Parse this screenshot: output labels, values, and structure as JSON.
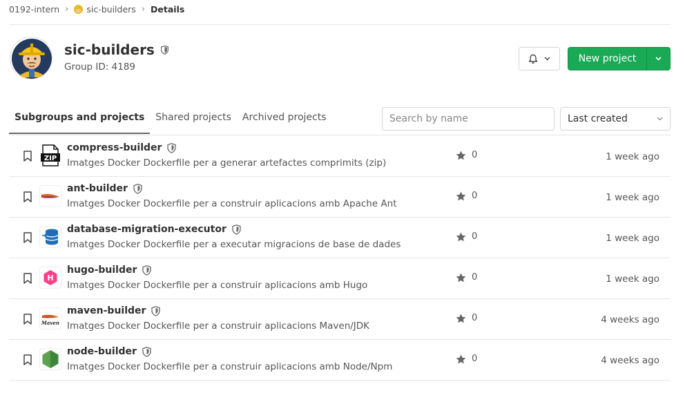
{
  "breadcrumb": {
    "items": [
      "0192-intern",
      "sic-builders",
      "Details"
    ]
  },
  "group": {
    "name": "sic-builders",
    "group_id_text": "Group ID: 4189"
  },
  "actions": {
    "new_project_label": "New project"
  },
  "tabs": [
    {
      "label": "Subgroups and projects",
      "active": true
    },
    {
      "label": "Shared projects",
      "active": false
    },
    {
      "label": "Archived projects",
      "active": false
    }
  ],
  "search": {
    "placeholder": "Search by name",
    "value": ""
  },
  "sort": {
    "selected": "Last created"
  },
  "projects": [
    {
      "name": "compress-builder",
      "description": "Imatges Docker Dockerfile per a generar artefactes comprimits (zip)",
      "stars": "0",
      "updated": "1 week ago",
      "icon": "zip-icon"
    },
    {
      "name": "ant-builder",
      "description": "Imatges Docker Dockerfile per a construir aplicacions amb Apache Ant",
      "stars": "0",
      "updated": "1 week ago",
      "icon": "ant-logo-icon"
    },
    {
      "name": "database-migration-executor",
      "description": "Imatges Docker Dockerfile per a executar migracions de base de dades",
      "stars": "0",
      "updated": "1 week ago",
      "icon": "database-icon"
    },
    {
      "name": "hugo-builder",
      "description": "Imatges Docker Dockerfile per a construir aplicacions amb Hugo",
      "stars": "0",
      "updated": "1 week ago",
      "icon": "hugo-logo-icon"
    },
    {
      "name": "maven-builder",
      "description": "Imatges Docker Dockerfile per a construir aplicacions Maven/JDK",
      "stars": "0",
      "updated": "4 weeks ago",
      "icon": "maven-logo-icon"
    },
    {
      "name": "node-builder",
      "description": "Imatges Docker Dockerfile per a construir aplicacions amb Node/Npm",
      "stars": "0",
      "updated": "4 weeks ago",
      "icon": "node-logo-icon"
    }
  ],
  "logo_texts": {
    "zip": "ZIP",
    "maven": "Maven",
    "hugo": "H"
  },
  "colors": {
    "primary_green": "#1aaa55",
    "text": "#303030",
    "muted": "#555555",
    "border": "#e5e5e5"
  }
}
